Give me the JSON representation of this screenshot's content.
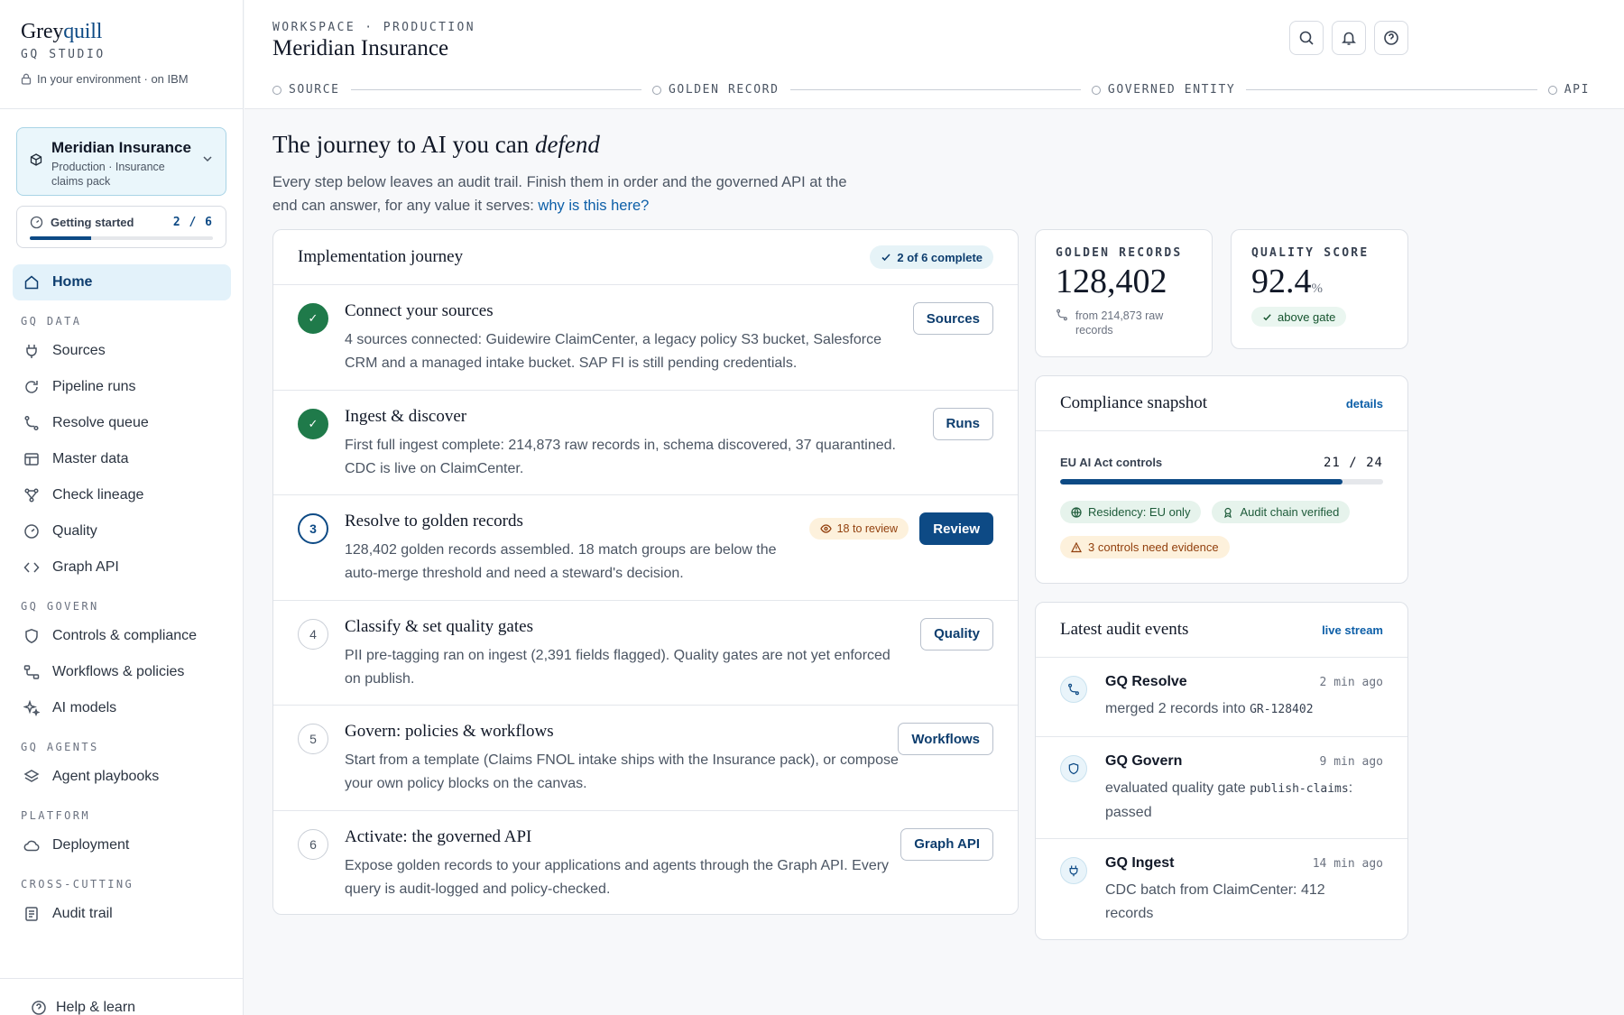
{
  "brand": {
    "name_a": "Grey",
    "name_b": "quill",
    "product": "GQ STUDIO",
    "env": "In your environment · on IBM"
  },
  "workspace_card": {
    "name": "Meridian Insurance",
    "meta": "Production · Insurance claims pack"
  },
  "getting_started": {
    "label": "Getting started",
    "count": "2 / 6",
    "progress": 0.333
  },
  "nav": {
    "home": "Home",
    "sections": {
      "data": "GQ DATA",
      "govern": "GQ GOVERN",
      "agents": "GQ AGENTS",
      "platform": "PLATFORM",
      "cross": "CROSS-CUTTING"
    },
    "items": {
      "sources": "Sources",
      "pipeline": "Pipeline runs",
      "resolve": "Resolve queue",
      "master": "Master data",
      "lineage": "Check lineage",
      "quality": "Quality",
      "graph": "Graph API",
      "controls": "Controls & compliance",
      "workflows": "Workflows & policies",
      "ai": "AI models",
      "playbooks": "Agent playbooks",
      "deployment": "Deployment",
      "audit": "Audit trail"
    },
    "help": "Help & learn"
  },
  "header": {
    "crumb": "WORKSPACE · PRODUCTION",
    "title": "Meridian Insurance",
    "steps": [
      "SOURCE",
      "GOLDEN RECORD",
      "GOVERNED ENTITY",
      "API"
    ]
  },
  "hero": {
    "title_a": "The journey to AI you can ",
    "title_em": "defend",
    "desc": "Every step below leaves an audit trail. Finish them in order and the governed API at the end can answer, for any value it serves: ",
    "link": "why is this here?"
  },
  "journey": {
    "title": "Implementation journey",
    "complete": "2 of 6 complete",
    "steps": [
      {
        "num": "✓",
        "title": "Connect your sources",
        "desc": "4 sources connected: Guidewire ClaimCenter, a legacy policy S3 bucket, Salesforce CRM and a managed intake bucket. SAP FI is still pending credentials.",
        "button": "Sources"
      },
      {
        "num": "✓",
        "title": "Ingest & discover",
        "desc": "First full ingest complete: 214,873 raw records in, schema discovered, 37 quarantined. CDC is live on ClaimCenter.",
        "button": "Runs"
      },
      {
        "num": "3",
        "title": "Resolve to golden records",
        "desc": "128,402 golden records assembled. 18 match groups are below the auto-merge threshold and need a steward's decision.",
        "button": "Review",
        "badge": "18 to review"
      },
      {
        "num": "4",
        "title": "Classify & set quality gates",
        "desc": "PII pre-tagging ran on ingest (2,391 fields flagged). Quality gates are not yet enforced on publish.",
        "button": "Quality"
      },
      {
        "num": "5",
        "title": "Govern: policies & workflows",
        "desc": "Start from a template (Claims FNOL intake ships with the Insurance pack), or compose your own policy blocks on the canvas.",
        "button": "Workflows"
      },
      {
        "num": "6",
        "title": "Activate: the governed API",
        "desc": "Expose golden records to your applications and agents through the Graph API. Every query is audit-logged and policy-checked.",
        "button": "Graph API"
      }
    ]
  },
  "stats": {
    "golden": {
      "label": "GOLDEN RECORDS",
      "value": "128,402",
      "sub": "from 214,873 raw records"
    },
    "quality": {
      "label": "QUALITY SCORE",
      "value": "92.4",
      "unit": "%",
      "badge": "above gate"
    }
  },
  "compliance": {
    "title": "Compliance snapshot",
    "link": "details",
    "control_label": "EU AI Act controls",
    "control_count": "21 / 24",
    "progress": 0.875,
    "chips": [
      "Residency: EU only",
      "Audit chain verified",
      "3 controls need evidence"
    ]
  },
  "audit": {
    "title": "Latest audit events",
    "link": "live stream",
    "events": [
      {
        "who": "GQ Resolve",
        "when": "2 min ago",
        "text": "merged 2 records into ",
        "code": "GR-128402",
        "tail": ""
      },
      {
        "who": "GQ Govern",
        "when": "9 min ago",
        "text": "evaluated quality gate ",
        "code": "publish-claims",
        "tail": ": passed"
      },
      {
        "who": "GQ Ingest",
        "when": "14 min ago",
        "text": "CDC batch from ClaimCenter: 412 records",
        "code": "",
        "tail": ""
      }
    ]
  },
  "colors": {
    "accent": "#0d4a85",
    "done": "#1f7a4a",
    "link": "#0d5fa8",
    "amber_bg": "#fdf1dc"
  }
}
